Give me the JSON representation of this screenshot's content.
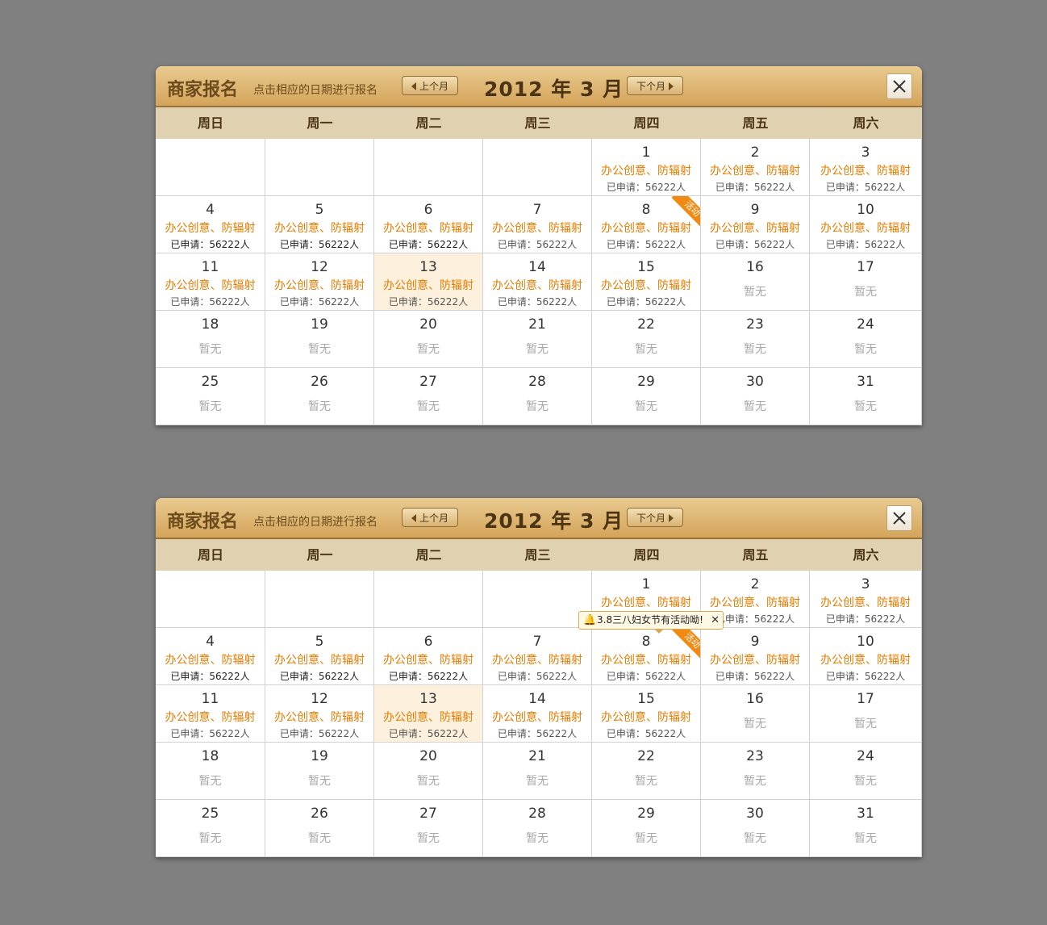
{
  "header": {
    "title": "商家报名",
    "subtitle": "点击相应的日期进行报名",
    "prev_label": "上个月",
    "next_label": "下个月",
    "month_label": "2012 年 3 月"
  },
  "weekdays": [
    "周日",
    "周一",
    "周二",
    "周三",
    "周四",
    "周五",
    "周六"
  ],
  "category_text": "办公创意、防辐射",
  "applied_text": "已申请：56222人",
  "none_text": "暂无",
  "ribbon_label": "活动",
  "tooltip": {
    "text": "3.8三八妇女节有活动呦!"
  },
  "colors": {
    "accent": "#e47c00",
    "ribbon": "#f08a10",
    "header": "#d4a45a",
    "today": "#fdf0dc"
  },
  "cells": [
    {
      "blank": true
    },
    {
      "blank": true
    },
    {
      "blank": true
    },
    {
      "blank": true
    },
    {
      "day": "1",
      "event": true
    },
    {
      "day": "2",
      "event": true
    },
    {
      "day": "3",
      "event": true
    },
    {
      "day": "4",
      "event": true,
      "dark": true
    },
    {
      "day": "5",
      "event": true,
      "dark": true
    },
    {
      "day": "6",
      "event": true,
      "dark": true
    },
    {
      "day": "7",
      "event": true
    },
    {
      "day": "8",
      "event": true,
      "ribbon": true
    },
    {
      "day": "9",
      "event": true
    },
    {
      "day": "10",
      "event": true
    },
    {
      "day": "11",
      "event": true
    },
    {
      "day": "12",
      "event": true
    },
    {
      "day": "13",
      "event": true,
      "today": true
    },
    {
      "day": "14",
      "event": true
    },
    {
      "day": "15",
      "event": true
    },
    {
      "day": "16"
    },
    {
      "day": "17"
    },
    {
      "day": "18"
    },
    {
      "day": "19"
    },
    {
      "day": "20"
    },
    {
      "day": "21"
    },
    {
      "day": "22"
    },
    {
      "day": "23"
    },
    {
      "day": "24"
    },
    {
      "day": "25"
    },
    {
      "day": "26"
    },
    {
      "day": "27"
    },
    {
      "day": "28"
    },
    {
      "day": "29"
    },
    {
      "day": "30"
    },
    {
      "day": "31"
    }
  ]
}
